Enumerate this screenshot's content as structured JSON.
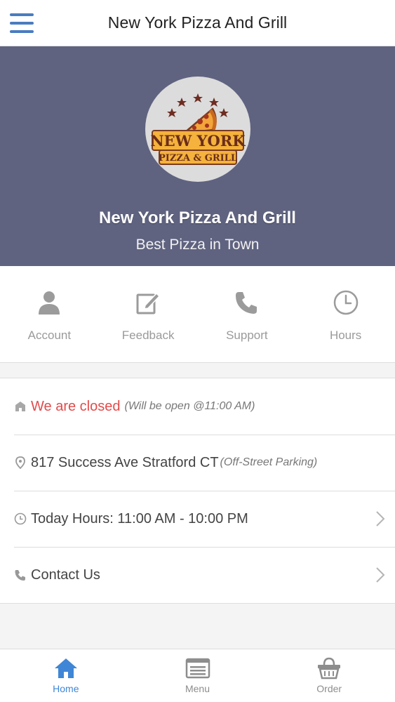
{
  "header": {
    "title": "New York Pizza And Grill"
  },
  "hero": {
    "logo_line1": "NEW YORK",
    "logo_line2": "PIZZA & GRILL",
    "restaurant_name": "New York Pizza And Grill",
    "tagline": "Best Pizza in Town"
  },
  "actions": [
    {
      "label": "Account",
      "icon": "user-icon"
    },
    {
      "label": "Feedback",
      "icon": "edit-icon"
    },
    {
      "label": "Support",
      "icon": "phone-icon"
    },
    {
      "label": "Hours",
      "icon": "clock-icon"
    }
  ],
  "info": {
    "status": {
      "text": "We are closed",
      "note": "(Will be open @11:00 AM)",
      "icon": "store-icon"
    },
    "address": {
      "text": "817 Success Ave Stratford CT",
      "note": "(Off-Street Parking)",
      "icon": "map-pin-icon"
    },
    "hours": {
      "text": "Today Hours: 11:00 AM - 10:00 PM",
      "icon": "clock-icon"
    },
    "contact": {
      "text": "Contact Us",
      "icon": "phone-icon"
    }
  },
  "bottom_nav": [
    {
      "label": "Home",
      "icon": "home-icon",
      "active": true
    },
    {
      "label": "Menu",
      "icon": "menu-list-icon",
      "active": false
    },
    {
      "label": "Order",
      "icon": "basket-icon",
      "active": false
    }
  ],
  "colors": {
    "accent": "#4a7cc0",
    "hero_bg": "#5f6380",
    "closed_red": "#e24b4b",
    "nav_active": "#3f86d6"
  }
}
